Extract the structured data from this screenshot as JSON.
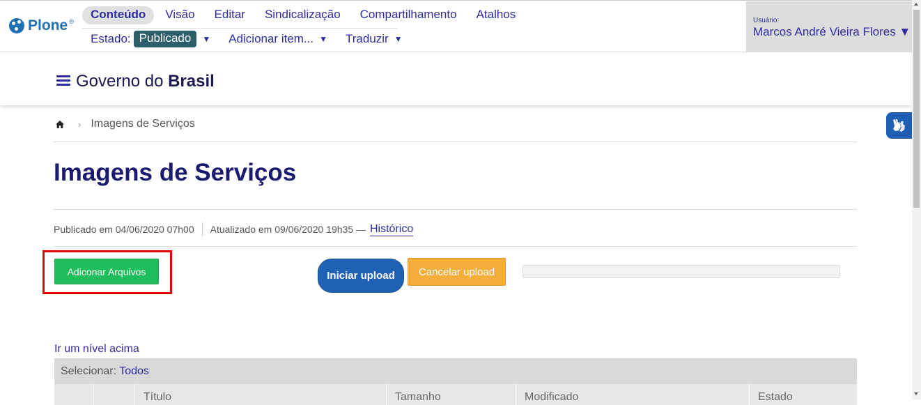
{
  "toolbar": {
    "logo_text": "Plone",
    "tabs": [
      {
        "label": "Conteúdo",
        "active": true
      },
      {
        "label": "Visão"
      },
      {
        "label": "Editar"
      },
      {
        "label": "Sindicalização"
      },
      {
        "label": "Compartilhamento"
      },
      {
        "label": "Atalhos"
      }
    ],
    "state_label": "Estado:",
    "state_value": "Publicado",
    "add_item_label": "Adicionar item...",
    "translate_label": "Traduzir",
    "caret": "▼",
    "user_label": "Usuário:",
    "user_name": "Marcos André Vieira Flores ▼"
  },
  "site": {
    "title_part1": "Governo do",
    "title_part2": "Brasil"
  },
  "breadcrumb": {
    "current": "Imagens de Serviços",
    "separator": "›"
  },
  "page": {
    "title": "Imagens de Serviços",
    "published": "Publicado em 04/06/2020 07h00",
    "updated": "Atualizado em 09/06/2020 19h35 —",
    "history_link": "Histórico"
  },
  "upload": {
    "add_files_label": "Adiconar Arquivos",
    "start_label": "Iniciar upload",
    "cancel_label": "Cancelar upload",
    "progress_fraction": 0
  },
  "listing": {
    "up_level_link": "Ir um nível acima",
    "select_label": "Selecionar:",
    "select_all_link": "Todos",
    "columns": [
      "",
      "",
      "Título",
      "Tamanho",
      "Modificado",
      "Estado"
    ]
  },
  "colors": {
    "accent": "#2d2d9e",
    "add_button": "#1fbd5b",
    "start_button": "#1f62b5",
    "cancel_button": "#f5ad3b",
    "highlight": "#e00000"
  },
  "icons": [
    "plone-logo-icon",
    "hamburger-icon",
    "home-icon",
    "accessibility-hands-icon"
  ]
}
